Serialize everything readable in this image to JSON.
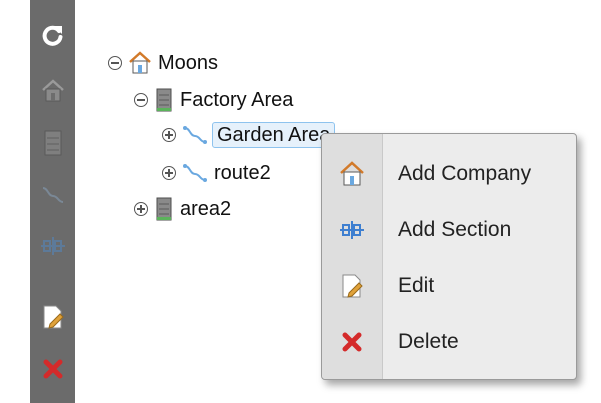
{
  "toolbar": {
    "buttons": [
      {
        "name": "refresh-button",
        "icon": "refresh-icon"
      },
      {
        "name": "add-company-button",
        "icon": "house-icon"
      },
      {
        "name": "add-area-button",
        "icon": "server-icon"
      },
      {
        "name": "add-route-button",
        "icon": "route-icon"
      },
      {
        "name": "add-section-button",
        "icon": "section-icon"
      },
      {
        "name": "edit-button",
        "icon": "edit-icon"
      },
      {
        "name": "delete-button",
        "icon": "delete-icon"
      }
    ]
  },
  "tree": {
    "root": {
      "label": "Moons",
      "icon": "house-icon",
      "expanded": true
    },
    "factory_area": {
      "label": "Factory Area",
      "icon": "server-icon",
      "expanded": true
    },
    "garden_area": {
      "label": "Garden Area",
      "icon": "route-icon",
      "expanded": false,
      "selected": true
    },
    "route2": {
      "label": "route2",
      "icon": "route-icon",
      "expanded": false
    },
    "area2": {
      "label": "area2",
      "icon": "server-icon",
      "expanded": false
    }
  },
  "context_menu": {
    "items": [
      {
        "label": "Add Company",
        "icon": "house-icon"
      },
      {
        "label": "Add Section",
        "icon": "section-icon"
      },
      {
        "label": "Edit",
        "icon": "edit-icon"
      },
      {
        "label": "Delete",
        "icon": "delete-icon"
      }
    ]
  },
  "colors": {
    "toolbar_bg": "#6b6b6b",
    "menu_bg": "#ececec",
    "selection_bg": "#e6f1fb",
    "delete_red": "#d42a2a",
    "route_blue": "#6aa8e0"
  }
}
